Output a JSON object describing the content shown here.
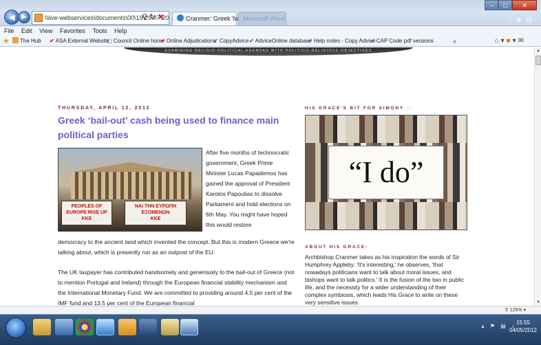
{
  "browser": {
    "address": "\\\\live-webservices\\documents\\00\\19\\29\\07\\20",
    "tabs": [
      {
        "label": "Cranmer: Greek 'bail...",
        "active": true
      },
      {
        "label": "Microsoft Word",
        "active": false
      }
    ],
    "menu": [
      "File",
      "Edit",
      "View",
      "Favorites",
      "Tools",
      "Help"
    ],
    "favorites": [
      "The Hub",
      "ASA External Website",
      "Council Online home",
      "Online Adjudications",
      "CopyAdvice",
      "AdviceOnline database",
      "Help notes - Copy Advice",
      "CAP Code pdf versions"
    ],
    "zoom": "125%"
  },
  "page": {
    "banner_text": "EXAMINING RELIGIO-POLITICAL AGENDAS WITH POLITICO-RELIGIOUS OBJECTIVES",
    "post_date": "THURSDAY, APRIL 12, 2012",
    "post_title": "Greek ‘bail-out’ cash being used to finance main political parties",
    "photo_signs": {
      "left": "PEOPLES OF EUROPE RISE UP",
      "left_party": "KKE",
      "right": "ΝΑΙ ΤΗΝ ΕΥΡΩΠΗ ΕΞΟΜΕΝΩΝ",
      "right_party": "KKE"
    },
    "paragraph_wrapped": "After five months of technocratic government, Greek Prime Minister Lucas Papademos has gained the approval of President Karolos Papoulias to dissolve Parliament and hold elections on 6th May. You might have hoped this would restore",
    "paragraph_continued": "democracy to the ancient land which invented the concept. But this is modern Greece we're talking about, which is presently run as an outpost of the EU.",
    "paragraph_2": "The UK taxpayer has contributed handsomely and generously to the bail-out of Greece (not to mention Portugal and Ireland) through the European financial stability mechanism and the International Monetary Fund. We are committed to providing around 4.5 per cent of the IMF fund and 13.5 per cent of the European financial",
    "side_heading_1": "HIS GRACE'S BIT FOR SIMONY",
    "side_heading_1_arrows": "↑↓",
    "i_do_text": "“I do”",
    "side_heading_2": "ABOUT HIS GRACE:",
    "about_text": "Archbishop Cranmer takes as his inspiration the words of Sir Humphrey Appleby: 'It's interesting,' he observes, 'that nowadays politicians want to talk about moral issues, and bishops want to talk politics.' It is the fusion of the two in public life, and the necessity for a wider understanding of their complex symbiosis, which leads His Grace to write on these very sensitive issues."
  },
  "taskbar": {
    "time": "15:55",
    "date": "04/05/2012"
  }
}
